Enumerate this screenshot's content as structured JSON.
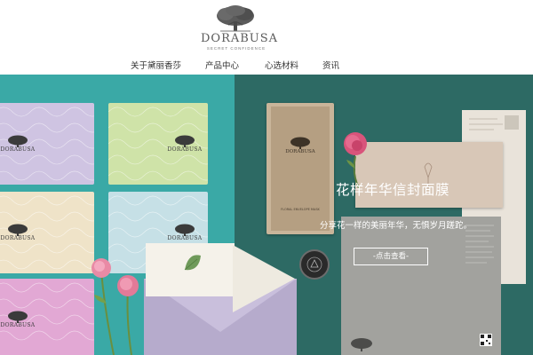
{
  "logo": {
    "wordmark": "DORABUSA",
    "tagline": "SECRET CONFIDENCE"
  },
  "nav": {
    "items": [
      {
        "label": "关于黛丽香莎"
      },
      {
        "label": "产品中心"
      },
      {
        "label": "心选材料"
      },
      {
        "label": "资讯"
      }
    ]
  },
  "banner": {
    "title": "花样年华信封面膜",
    "subtitle": "分享花一样的美丽年华，无惧岁月蹉跎。",
    "button_label": "-点击查看-",
    "card_brand": "DORABUSA",
    "sachet_text": "FLORAL ENVELOPE MASK"
  },
  "colors": {
    "left_bg": "#3aa9a6",
    "right_bg": "#2d6a64",
    "text": "#333333",
    "white": "#ffffff"
  },
  "icons": [
    "tree-logo-icon",
    "rose-icon",
    "leaf-icon",
    "qr-code-icon"
  ]
}
